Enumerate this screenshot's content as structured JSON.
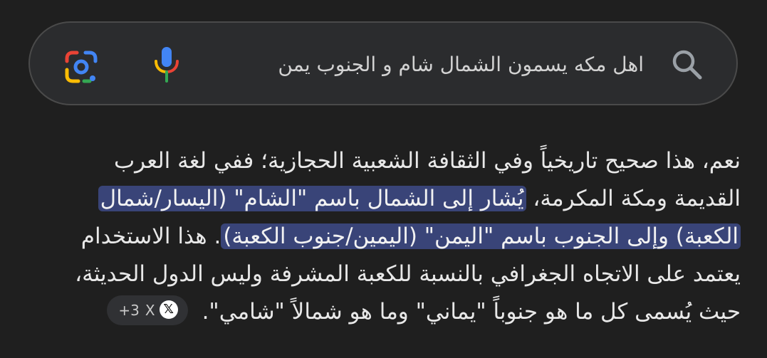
{
  "search": {
    "query": "اهل مكه يسمون الشمال شام و الجنوب يمن",
    "search_icon": "search-icon",
    "mic_icon": "mic-icon",
    "lens_icon": "google-lens-icon"
  },
  "answer": {
    "line1": "نعم، هذا صحيح تاريخياً وفي الثقافة الشعبية الحجازية؛ ففي لغة العرب",
    "line2_plain": "القديمة ومكة المكرمة، ",
    "line2_highlight": "يُشار إلى الشمال باسم \"الشام\" (اليسار/شمال",
    "line3_highlight": "الكعبة) وإلى الجنوب باسم \"اليمن\" (اليمين/جنوب الكعبة)",
    "line3_plain": ". هذا الاستخدام",
    "line4": "يعتمد على الاتجاه الجغرافي بالنسبة للكعبة المشرفة وليس الدول الحديثة،",
    "line5": "حيث يُسمى كل ما هو جنوباً \"يماني\" وما هو شمالاً \"شامي\"."
  },
  "source_chip": {
    "badge": "𝕏",
    "source": "X",
    "count": "+3"
  },
  "colors": {
    "background": "#1f1f1f",
    "search_bar": "#2b2c2e",
    "highlight": "#394478"
  }
}
